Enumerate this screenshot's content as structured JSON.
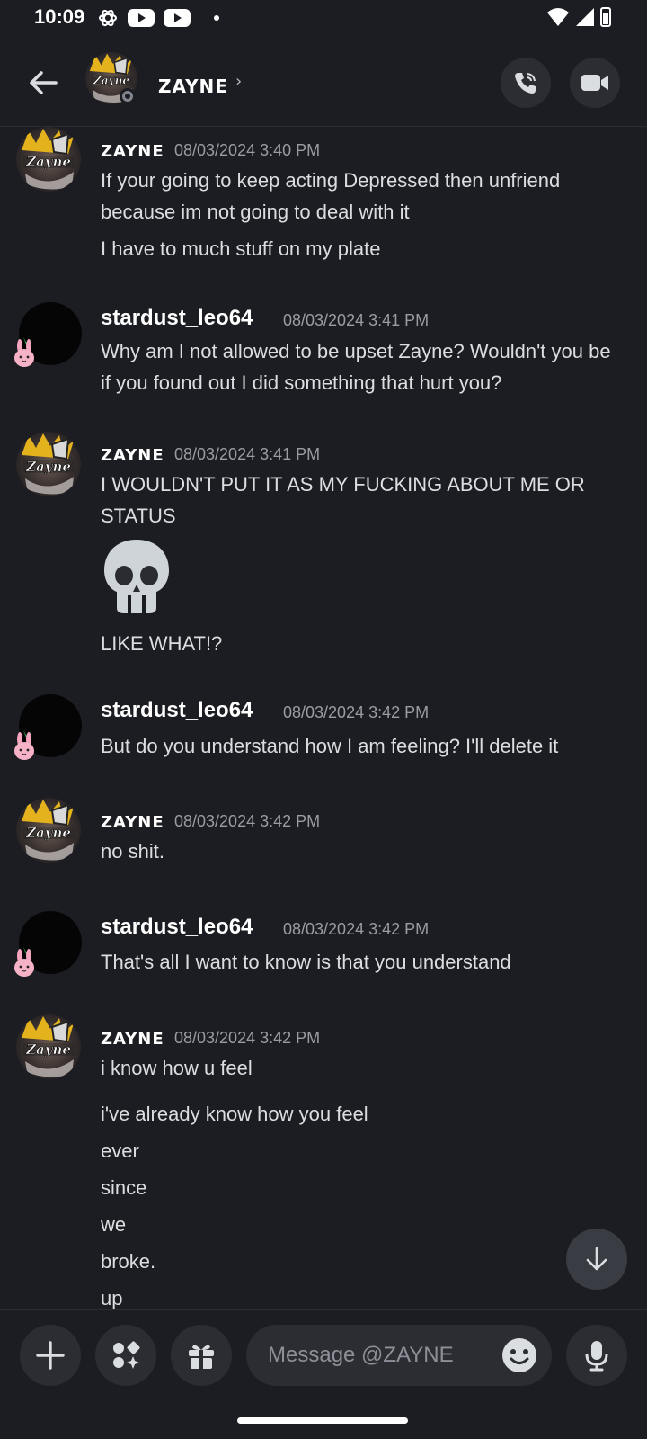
{
  "status_bar": {
    "time": "10:09"
  },
  "header": {
    "title": "ZAYNE",
    "chevron": "›",
    "back_icon": "arrow-left-icon",
    "call_icon": "phone-call-icon",
    "video_icon": "video-camera-icon"
  },
  "messages": [
    {
      "author": "ZAYNE",
      "time": "08/03/2024 3:40 PM",
      "lines": [
        "If your going to keep acting Depressed then unfriend",
        "because im not going to deal with it"
      ],
      "extra": [
        "I have to much stuff on my plate"
      ]
    },
    {
      "author": "stardust_leo64",
      "time": "08/03/2024 3:41 PM",
      "lines": [
        "Why am I not allowed to be upset Zayne? Wouldn't you be",
        "if you found out I did something that hurt you?"
      ]
    },
    {
      "author": "ZAYNE",
      "time": "08/03/2024 3:41 PM",
      "lines": [
        "I WOULDN'T PUT IT AS MY FUCKING ABOUT ME OR",
        "STATUS"
      ],
      "emoji": "skull-emoji",
      "extra": [
        "LIKE WHAT!?"
      ]
    },
    {
      "author": "stardust_leo64",
      "time": "08/03/2024 3:42 PM",
      "lines": [
        "But do you understand how I am feeling? I'll delete it"
      ]
    },
    {
      "author": "ZAYNE",
      "time": "08/03/2024 3:42 PM",
      "lines": [
        "no shit."
      ]
    },
    {
      "author": "stardust_leo64",
      "time": "08/03/2024 3:42 PM",
      "lines": [
        "That's all I want to know is that you understand"
      ]
    },
    {
      "author": "ZAYNE",
      "time": "08/03/2024 3:42 PM",
      "lines": [
        "i know how u feel"
      ],
      "extra": [
        "i've already know how you feel",
        "ever",
        "since",
        "we",
        "broke.",
        "up"
      ]
    }
  ],
  "composer": {
    "placeholder": "Message @ZAYNE",
    "add_icon": "plus-icon",
    "apps_icon": "apps-icon",
    "gift_icon": "gift-icon",
    "emoji_icon": "smile-icon",
    "mic_icon": "microphone-icon"
  },
  "scroll_button_icon": "arrow-down-icon",
  "colors": {
    "background": "#1c1d22",
    "surface": "#2b2d33",
    "text": "#dbdee1",
    "timestamp": "#9a9ca4"
  }
}
